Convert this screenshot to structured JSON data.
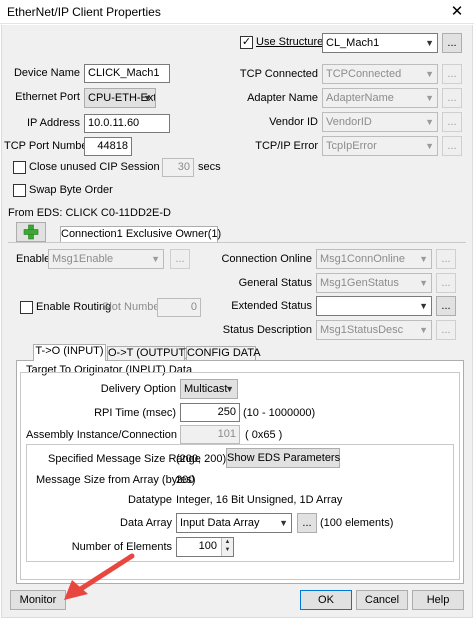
{
  "window": {
    "title": "EtherNet/IP Client Properties",
    "close_glyph": "✕"
  },
  "left_fields": {
    "device_name_label": "Device Name",
    "device_name_value": "CLICK_Mach1",
    "ethernet_port_label": "Ethernet Port",
    "ethernet_port_value": "CPU-ETH-Ext",
    "ip_address_label": "IP Address",
    "ip_address_value": "10.0.11.60",
    "tcp_port_label": "TCP Port Number",
    "tcp_port_value": "44818",
    "close_unused_label": "Close unused CIP Session after",
    "close_unused_checked": false,
    "close_unused_value": "30",
    "close_unused_unit": "secs",
    "swap_byte_label": "Swap Byte Order",
    "swap_byte_checked": false
  },
  "right_fields": {
    "use_structure_label": "Use Structure",
    "use_structure_checked": true,
    "use_structure_check": "✓",
    "structure_value": "CL_Mach1",
    "tcp_connected_label": "TCP Connected",
    "tcp_connected_value": "TCPConnected",
    "adapter_name_label": "Adapter Name",
    "adapter_name_value": "AdapterName",
    "vendor_id_label": "Vendor ID",
    "vendor_id_value": "VendorID",
    "tcpip_error_label": "TCP/IP Error",
    "tcpip_error_value": "TcpIpError",
    "ellipsis": "..."
  },
  "eds": {
    "from_eds_label": "From EDS: CLICK C0-11DD2E-D",
    "add_icon": "add-connection-icon",
    "connection_tab_label": "Connection1 Exclusive Owner(1)"
  },
  "connection": {
    "enable_label": "Enable",
    "enable_value": "Msg1Enable",
    "enable_routing_label": "Enable Routing",
    "enable_routing_checked": false,
    "slot_number_label": "Slot Number",
    "slot_number_value": "0",
    "connection_online_label": "Connection Online",
    "connection_online_value": "Msg1ConnOnline",
    "general_status_label": "General Status",
    "general_status_value": "Msg1GenStatus",
    "extended_status_label": "Extended Status",
    "extended_status_value": "",
    "status_description_label": "Status Description",
    "status_description_value": "Msg1StatusDesc"
  },
  "tabs": [
    {
      "label": "T->O (INPUT)",
      "active": true
    },
    {
      "label": "O->T (OUTPUT)",
      "active": false
    },
    {
      "label": "CONFIG DATA",
      "active": false
    }
  ],
  "input_tab": {
    "group_title": "Target To Originator (INPUT) Data",
    "delivery_option_label": "Delivery Option",
    "delivery_option_value": "Multicast",
    "rpi_label": "RPI Time (msec)",
    "rpi_value": "250",
    "rpi_range": "(10 - 1000000)",
    "assembly_label": "Assembly Instance/Connection Point",
    "assembly_value": "101",
    "assembly_hex": "( 0x65 )",
    "msg_size_range_label": "Specified Message Size Range",
    "msg_size_range_value": "(200, 200)",
    "show_eds_button": "Show EDS Parameters",
    "msg_size_array_label": "Message Size from Array (bytes)",
    "msg_size_array_value": "200",
    "datatype_label": "Datatype",
    "datatype_value": "Integer, 16 Bit Unsigned, 1D Array",
    "data_array_label": "Data Array",
    "data_array_value": "Input Data Array",
    "data_array_elements": "(100 elements)",
    "num_elements_label": "Number of Elements",
    "num_elements_value": "100"
  },
  "footer": {
    "monitor_button": "Monitor",
    "ok_button": "OK",
    "cancel_button": "Cancel",
    "help_button": "Help"
  },
  "colors": {
    "arrow": "#e8473f",
    "add_icon": "#3aa832",
    "default_button_border": "#0078d7"
  }
}
